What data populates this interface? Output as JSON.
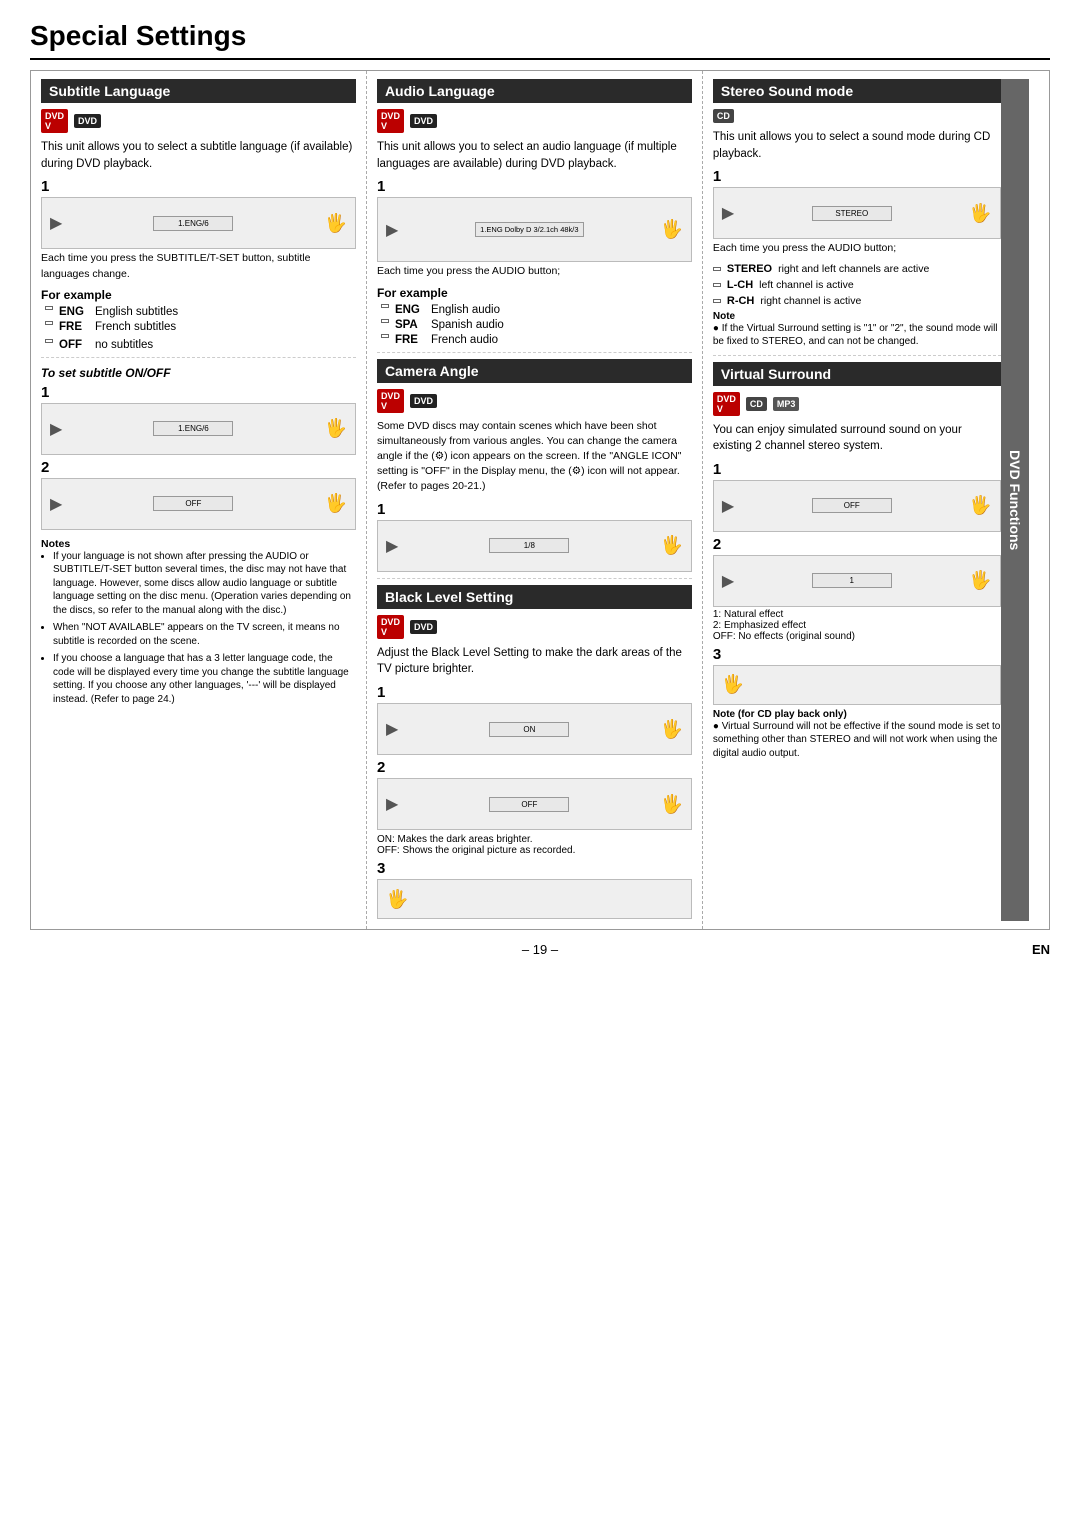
{
  "page": {
    "title": "Special Settings",
    "page_number": "– 19 –",
    "lang_label": "EN"
  },
  "col1": {
    "subtitle_language": {
      "header": "Subtitle Language",
      "icons": [
        "DVD-V",
        "DVD"
      ],
      "description": "This unit allows you to select a subtitle language (if available) during DVD playback.",
      "step1_label": "1",
      "step1_screen": "1.ENG/6",
      "step1_caption": "Each time you press the SUBTITLE/T-SET button, subtitle languages change.",
      "for_example_label": "For example",
      "examples": [
        {
          "code": "ENG",
          "desc": "English subtitles"
        },
        {
          "code": "FRE",
          "desc": "French subtitles"
        },
        {
          "code": "OFF",
          "desc": "no subtitles"
        }
      ]
    },
    "to_set_subtitle": {
      "header": "To set subtitle ON/OFF",
      "step1_screen": "1.ENG/6",
      "step2_screen": "OFF",
      "notes_title": "Notes",
      "notes": [
        "If your language is not shown after pressing the AUDIO or SUBTITLE/T-SET button several times, the disc may not have that language. However, some discs allow audio language or subtitle language setting on the disc menu. (Operation varies depending on the discs, so refer to the manual along with the disc.)",
        "When \"NOT AVAILABLE\" appears on the TV screen, it means no subtitle is recorded on the scene.",
        "If you choose a language that has a 3 letter language code, the code will be displayed every time you change the subtitle language setting. If you choose any other languages, '---' will be displayed instead. (Refer to page 24.)"
      ]
    }
  },
  "col2": {
    "audio_language": {
      "header": "Audio Language",
      "icons": [
        "DVD-V",
        "DVD"
      ],
      "description": "This unit allows you to select an audio language (if multiple languages are available) during DVD playback.",
      "step1_label": "1",
      "step1_screen": "1.ENG Dolby D 3/2.1ch 48k/3",
      "step1_caption": "Each time you press the AUDIO button;",
      "for_example_label": "For example",
      "examples": [
        {
          "code": "ENG",
          "desc": "English audio"
        },
        {
          "code": "SPA",
          "desc": "Spanish audio"
        },
        {
          "code": "FRE",
          "desc": "French audio"
        }
      ]
    },
    "camera_angle": {
      "header": "Camera Angle",
      "icons": [
        "DVD-V",
        "DVD"
      ],
      "description": "Some DVD discs may contain scenes which have been shot simultaneously from various angles. You can change the camera angle if the (⚙) icon appears on the screen. If the \"ANGLE ICON\" setting is \"OFF\" in the Display menu, the (⚙) icon will not appear. (Refer to pages 20-21.)",
      "step1_screen": "1/8"
    },
    "black_level": {
      "header": "Black Level Setting",
      "icons": [
        "DVD-V",
        "DVD"
      ],
      "description": "Adjust the Black Level Setting to make the dark areas of the TV picture brighter.",
      "step1_screen": "ON",
      "step2_screen": "OFF",
      "step3_label": "3",
      "captions": [
        "ON: Makes the dark areas brighter.",
        "OFF: Shows the original picture as recorded."
      ]
    }
  },
  "col3": {
    "stereo_sound": {
      "header": "Stereo Sound mode",
      "icons": [
        "CD"
      ],
      "description": "This unit allows you to select a sound mode during CD playback.",
      "step1_label": "1",
      "step1_screen": "STEREO",
      "step1_caption": "Each time you press the AUDIO button;",
      "examples": [
        {
          "code": "STEREO",
          "desc": "right and left channels are active"
        },
        {
          "code": "L-CH",
          "desc": "left channel is active"
        },
        {
          "code": "R-CH",
          "desc": "right channel is active"
        }
      ],
      "note_title": "Note",
      "note_body": "● If the Virtual Surround setting is \"1\" or \"2\", the sound mode will be fixed to STEREO, and can not be changed."
    },
    "virtual_surround": {
      "header": "Virtual Surround",
      "icons": [
        "DVD-V",
        "CD",
        "MP3"
      ],
      "description": "You can enjoy simulated surround sound on your existing 2 channel stereo system.",
      "step1_screen": "OFF",
      "step2_screen": "1",
      "step2_captions": [
        "1: Natural effect",
        "2: Emphasized effect",
        "OFF: No effects (original sound)"
      ],
      "step3_label": "3",
      "note_title": "Note (for CD play back only)",
      "note_body": "● Virtual Surround will not be effective if the sound mode is set to something other than STEREO and will not work when using the digital audio output."
    }
  },
  "dvd_functions_label": "DVD Functions"
}
